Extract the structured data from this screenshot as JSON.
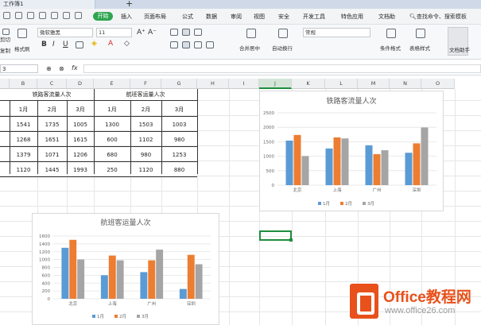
{
  "window": {
    "doc_title": "工作簿1",
    "new_tab": "+"
  },
  "menu": {
    "start": "开始",
    "items": [
      "插入",
      "页面布局",
      "公式",
      "数据",
      "审阅",
      "视图",
      "安全",
      "开发工具",
      "特色应用",
      "文档助"
    ],
    "search": "查找命令、搜索模板"
  },
  "ribbon": {
    "cut": "剪切",
    "copy": "复制",
    "format_painter": "格式刷",
    "font_name": "微软雅黑",
    "font_size": "11",
    "format": "常规",
    "merge_center": "合并居中",
    "wrap": "自动换行",
    "cond_format": "条件格式",
    "table_style": "表格样式",
    "assistant": "文档助手"
  },
  "formula_bar": {
    "cell_ref": "3",
    "fx": "fx"
  },
  "columns": [
    "B",
    "C",
    "D",
    "E",
    "F",
    "G",
    "H",
    "I",
    "J",
    "K",
    "L",
    "M",
    "N",
    "O"
  ],
  "table": {
    "rail_header": "铁路客流量人次",
    "air_header": "航班客运量人次",
    "months": [
      "1月",
      "2月",
      "3月"
    ],
    "rows": [
      [
        "1541",
        "1735",
        "1005",
        "1300",
        "1503",
        "1003"
      ],
      [
        "1268",
        "1651",
        "1615",
        "600",
        "1102",
        "980"
      ],
      [
        "1379",
        "1071",
        "1206",
        "680",
        "980",
        "1253"
      ],
      [
        "1120",
        "1445",
        "1993",
        "250",
        "1120",
        "880"
      ]
    ]
  },
  "chart_data": [
    {
      "type": "bar",
      "title": "铁路客流量人次",
      "categories": [
        "北京",
        "上海",
        "广州",
        "深圳"
      ],
      "series": [
        {
          "name": "1月",
          "values": [
            1541,
            1268,
            1379,
            1120
          ],
          "color": "#5b9bd5"
        },
        {
          "name": "2月",
          "values": [
            1735,
            1651,
            1071,
            1445
          ],
          "color": "#ed7d31"
        },
        {
          "name": "3月",
          "values": [
            1005,
            1615,
            1206,
            1993
          ],
          "color": "#a5a5a5"
        }
      ],
      "ylim": [
        0,
        2500
      ],
      "yticks": [
        "0",
        "500",
        "1000",
        "1500",
        "2000",
        "2500"
      ],
      "legend": "bottom",
      "grid": true
    },
    {
      "type": "bar",
      "title": "航班客运量人次",
      "categories": [
        "北京",
        "上海",
        "广州",
        "深圳"
      ],
      "series": [
        {
          "name": "1月",
          "values": [
            1300,
            600,
            680,
            250
          ],
          "color": "#5b9bd5"
        },
        {
          "name": "2月",
          "values": [
            1503,
            1102,
            980,
            1120
          ],
          "color": "#ed7d31"
        },
        {
          "name": "3月",
          "values": [
            1003,
            980,
            1253,
            880
          ],
          "color": "#a5a5a5"
        }
      ],
      "ylim": [
        0,
        1600
      ],
      "yticks": [
        "0",
        "200",
        "400",
        "600",
        "800",
        "1000",
        "1200",
        "1400",
        "1600"
      ],
      "legend": "bottom",
      "grid": true
    }
  ],
  "watermark": {
    "title": "Office教程网",
    "url": "www.office26.com"
  }
}
